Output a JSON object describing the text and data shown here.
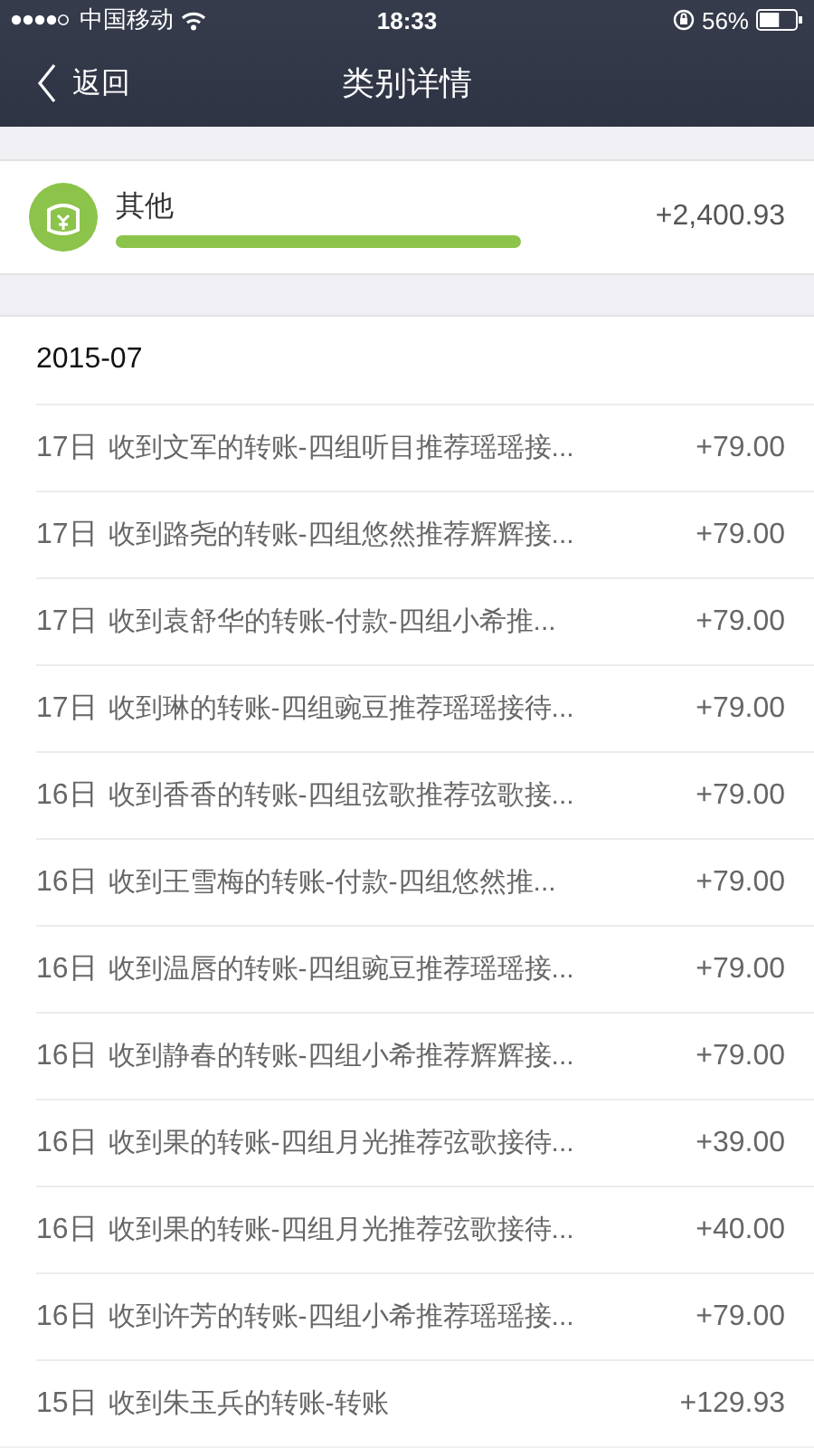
{
  "status_bar": {
    "carrier": "中国移动",
    "time": "18:33",
    "battery": "56%"
  },
  "nav": {
    "back": "返回",
    "title": "类别详情"
  },
  "summary": {
    "category": "其他",
    "amount": "+2,400.93"
  },
  "month": "2015-07",
  "rows": [
    {
      "day": "17日",
      "desc": "收到文军的转账-四组听目推荐瑶瑶接...",
      "amount": "+79.00"
    },
    {
      "day": "17日",
      "desc": "收到路尧的转账-四组悠然推荐辉辉接...",
      "amount": "+79.00"
    },
    {
      "day": "17日",
      "desc": "收到袁舒华的转账-付款-四组小希推...",
      "amount": "+79.00"
    },
    {
      "day": "17日",
      "desc": "收到琳的转账-四组豌豆推荐瑶瑶接待...",
      "amount": "+79.00"
    },
    {
      "day": "16日",
      "desc": "收到香香的转账-四组弦歌推荐弦歌接...",
      "amount": "+79.00"
    },
    {
      "day": "16日",
      "desc": "收到王雪梅的转账-付款-四组悠然推...",
      "amount": "+79.00"
    },
    {
      "day": "16日",
      "desc": "收到温唇的转账-四组豌豆推荐瑶瑶接...",
      "amount": "+79.00"
    },
    {
      "day": "16日",
      "desc": "收到静春的转账-四组小希推荐辉辉接...",
      "amount": "+79.00"
    },
    {
      "day": "16日",
      "desc": "收到果的转账-四组月光推荐弦歌接待...",
      "amount": "+39.00"
    },
    {
      "day": "16日",
      "desc": "收到果的转账-四组月光推荐弦歌接待...",
      "amount": "+40.00"
    },
    {
      "day": "16日",
      "desc": "收到许芳的转账-四组小希推荐瑶瑶接...",
      "amount": "+79.00"
    },
    {
      "day": "15日",
      "desc": "收到朱玉兵的转账-转账",
      "amount": "+129.93"
    }
  ]
}
